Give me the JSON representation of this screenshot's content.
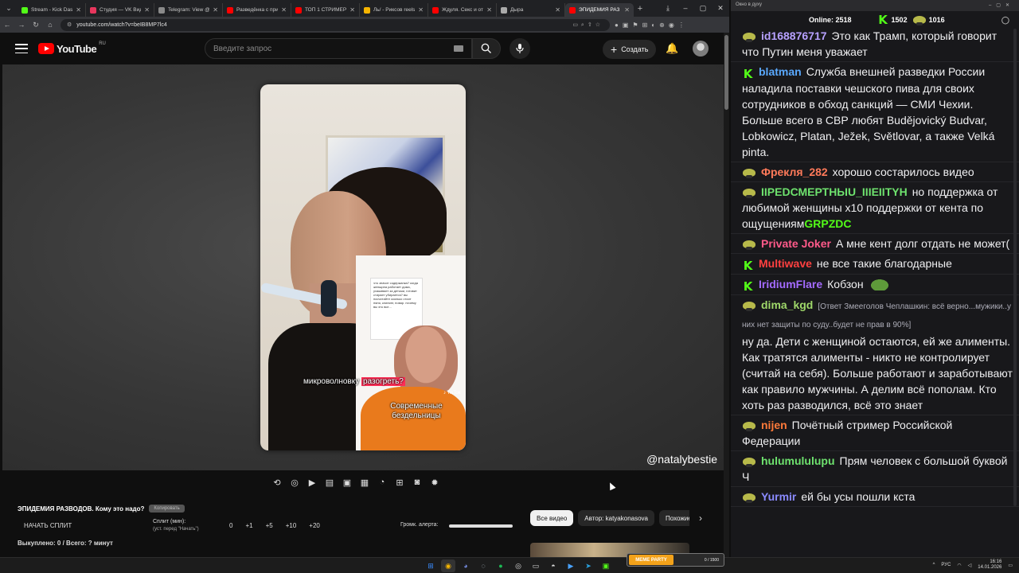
{
  "browser": {
    "tabs": [
      {
        "label": "Stream - Kick Dashb",
        "color": "#53fc18",
        "active": false
      },
      {
        "label": "Студия — VK Видео",
        "color": "#e8365d",
        "active": false
      },
      {
        "label": "Telegram: View @Fi",
        "color": "#8a8a8a",
        "active": false
      },
      {
        "label": "Разведёнка с прице",
        "color": "#ff0000",
        "active": false
      },
      {
        "label": "ТОП 1 СТРИМЕР В",
        "color": "#ff0000",
        "active": false
      },
      {
        "label": "Ль/ - Риксов reels",
        "color": "#f5b400",
        "active": false
      },
      {
        "label": "Ждуля. Секс и отн",
        "color": "#ff0000",
        "active": false
      },
      {
        "label": "Дыра",
        "color": "#aaaaaa",
        "active": false
      },
      {
        "label": "ЭПИДЕМИЯ РАЗ",
        "color": "#ff0000",
        "active": true
      }
    ],
    "url": "youtube.com/watch?v=beIB8MP7lc4"
  },
  "youtube": {
    "region": "RU",
    "brand": "YouTube",
    "search_placeholder": "Введите запрос",
    "create_label": "Создать"
  },
  "video": {
    "caption_prefix": "микроволновку ",
    "caption_highlight": "разогреть?",
    "caption2": "Современные бездельницы",
    "tiktok_tag": "♪ TikTok",
    "inset_text": "что значит содержанка? когда женщина работает дома, ухаживает за детьми, готовит стирает убирается? вы посчитайте сколько стоит няня, клининг, повар. почему вы это все...",
    "watermark": "@natalybestie"
  },
  "stream_panel": {
    "title": "ЭПИДЕМИЯ РАЗВОДОВ. Кому это надо?",
    "copy_label": "Копировать",
    "start_split": "НАЧАТЬ СПЛИТ",
    "split_label": "Сплит (мин):",
    "split_note": "(уст. перед \"Начать\")",
    "split_values": [
      "0",
      "+1",
      "+5",
      "+10",
      "+20"
    ],
    "bought": "Выкуплено: 0 / Всего: ? минут",
    "alert_label": "Громк. алерта:",
    "alert_volume": 1.0
  },
  "chips": [
    "Все видео",
    "Автор: katyakonasova",
    "Похожие"
  ],
  "chat": {
    "window_title": "Окно в духу",
    "online_label": "Online:",
    "online_count": "2518",
    "kick_count": "1502",
    "other_count": "1016",
    "messages": [
      {
        "badge": "frog",
        "user": "id168876717",
        "color": "#b7a1ff",
        "text": "Это как Трамп, который говорит что Путин меня уважает"
      },
      {
        "badge": "k",
        "user": "blatman",
        "color": "#5aa9ff",
        "text": "Служба внешней разведки России наладила поставки чешского пива для своих сотрудников в обход санкций — СМИ Чехии. Больше всего в СВР любят Budějovický Budvar, Lobkowicz, Platan, Ježek, Světlovar, а также Velká pinta."
      },
      {
        "badge": "frog",
        "user": "Фрекля_282",
        "color": "#ff7a5a",
        "text": "хорошо состарилось видео"
      },
      {
        "badge": "frog",
        "user": "IIРЕDСМЕРТНЫU_IIIEIITYH",
        "color": "#6ee26e",
        "text": "но поддержка от любимой женщины x10 поддержки от кента по ощущениям",
        "emote": "GRPZDC"
      },
      {
        "badge": "frog",
        "user": "Private Joker",
        "color": "#ff5a8a",
        "text": "А мне кент долг отдать не может("
      },
      {
        "badge": "k",
        "user": "Multiwave",
        "color": "#ff4040",
        "text": "не все такие благодарные"
      },
      {
        "badge": "k",
        "user": "IridiumFlare",
        "color": "#a46bff",
        "text": "Кобзон",
        "pepe": true
      },
      {
        "badge": "frog",
        "user": "dima_kgd",
        "color": "#9fd86a",
        "reply": "[Ответ Змееголов Чеплашкин: всё верно...мужики..у них нет защиты по суду..будет не прав в 90%]",
        "text": "ну да. Дети с женщиной остаются, ей же алименты. Как тратятся алименты - никто не контролирует (считай на себя). Больше работают и заработывают как правило мужчины. А делим всё пополам. Кто хоть раз разводился, всё это знает"
      },
      {
        "badge": "frog",
        "user": "nijen",
        "color": "#ff7a3a",
        "text": "Почётный стример Российской Федерации"
      },
      {
        "badge": "frog",
        "user": "hulumululupu",
        "color": "#6ee26e",
        "text": "Прям человек с большой буквой Ч"
      },
      {
        "badge": "frog",
        "user": "Yurmir",
        "color": "#8a8aff",
        "text": "ей бы усы пошли кста"
      }
    ]
  },
  "taskbar": {
    "meme_label": "MEME PARTY",
    "meme_value": "0 / 1500",
    "lang": "РУС",
    "time": "16:16",
    "date": "14.01.2026"
  }
}
